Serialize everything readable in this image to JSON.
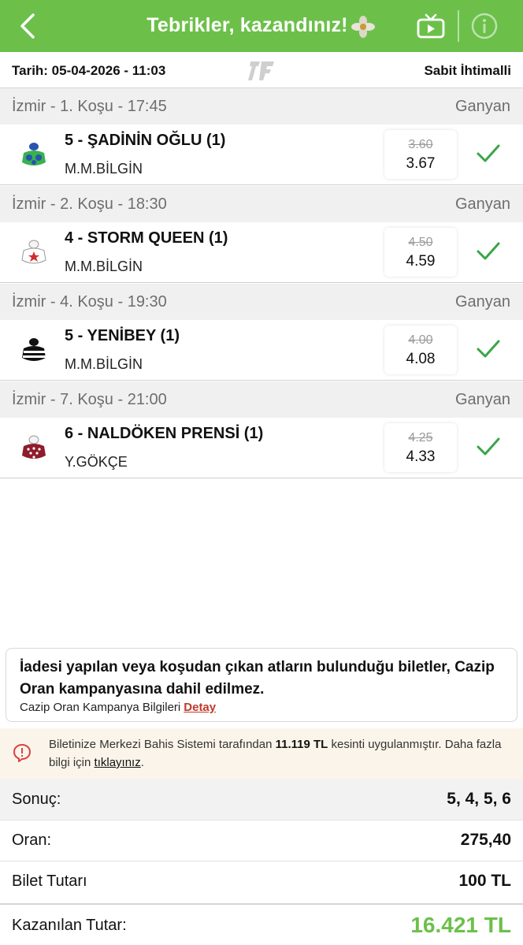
{
  "header": {
    "title": "Tebrikler, kazandınız!",
    "back_icon": "chevron-left-icon",
    "tv_icon": "tv-icon",
    "info_icon": "info-icon",
    "bg_color": "#6cc04a"
  },
  "ticket": {
    "date": "Tarih: 05-04-2026 - 11:03",
    "bet_mode": "Sabit İhtimalli"
  },
  "races": [
    {
      "header_left": "İzmir - 1. Koşu - 17:45",
      "header_right": "Ganyan",
      "horse": "5 - ŞADİNİN OĞLU (1)",
      "jockey": "M.M.BİLGİN",
      "odds_old": "3.60",
      "odds_new": "3.67",
      "silk": "green-blue-silk"
    },
    {
      "header_left": "İzmir - 2. Koşu - 18:30",
      "header_right": "Ganyan",
      "horse": "4 - STORM QUEEN (1)",
      "jockey": "M.M.BİLGİN",
      "odds_old": "4.50",
      "odds_new": "4.59",
      "silk": "white-red-star-silk"
    },
    {
      "header_left": "İzmir - 4. Koşu - 19:30",
      "header_right": "Ganyan",
      "horse": "5 - YENİBEY (1)",
      "jockey": "M.M.BİLGİN",
      "odds_old": "4.00",
      "odds_new": "4.08",
      "silk": "black-white-stripe-silk"
    },
    {
      "header_left": "İzmir - 7. Koşu - 21:00",
      "header_right": "Ganyan",
      "horse": "6 - NALDÖKEN PRENSİ (1)",
      "jockey": "Y.GÖKÇE",
      "odds_old": "4.25",
      "odds_new": "4.33",
      "silk": "maroon-dots-silk"
    }
  ],
  "campaign": {
    "text": "İadesi yapılan veya koşudan çıkan atların bulunduğu biletler, Cazip Oran kampanyasına dahil edilmez.",
    "sub_label": "Cazip Oran Kampanya Bilgileri",
    "link": "Detay"
  },
  "warning": {
    "text_before": "Biletinize Merkezi Bahis Sistemi tarafından ",
    "amount": "11.119 TL",
    "text_after": " kesinti uygulanmıştır. Daha fazla bilgi için ",
    "link": "tıklayınız",
    "text_end": "."
  },
  "summary": {
    "result_label": "Sonuç:",
    "result_value": "5, 4, 5, 6",
    "odds_label": "Oran:",
    "odds_value": "275,40",
    "stake_label": "Bilet Tutarı",
    "stake_value": "100 TL",
    "win_label": "Kazanılan Tutar:",
    "win_value": "16.421 TL",
    "win_color": "#6cc04a"
  }
}
